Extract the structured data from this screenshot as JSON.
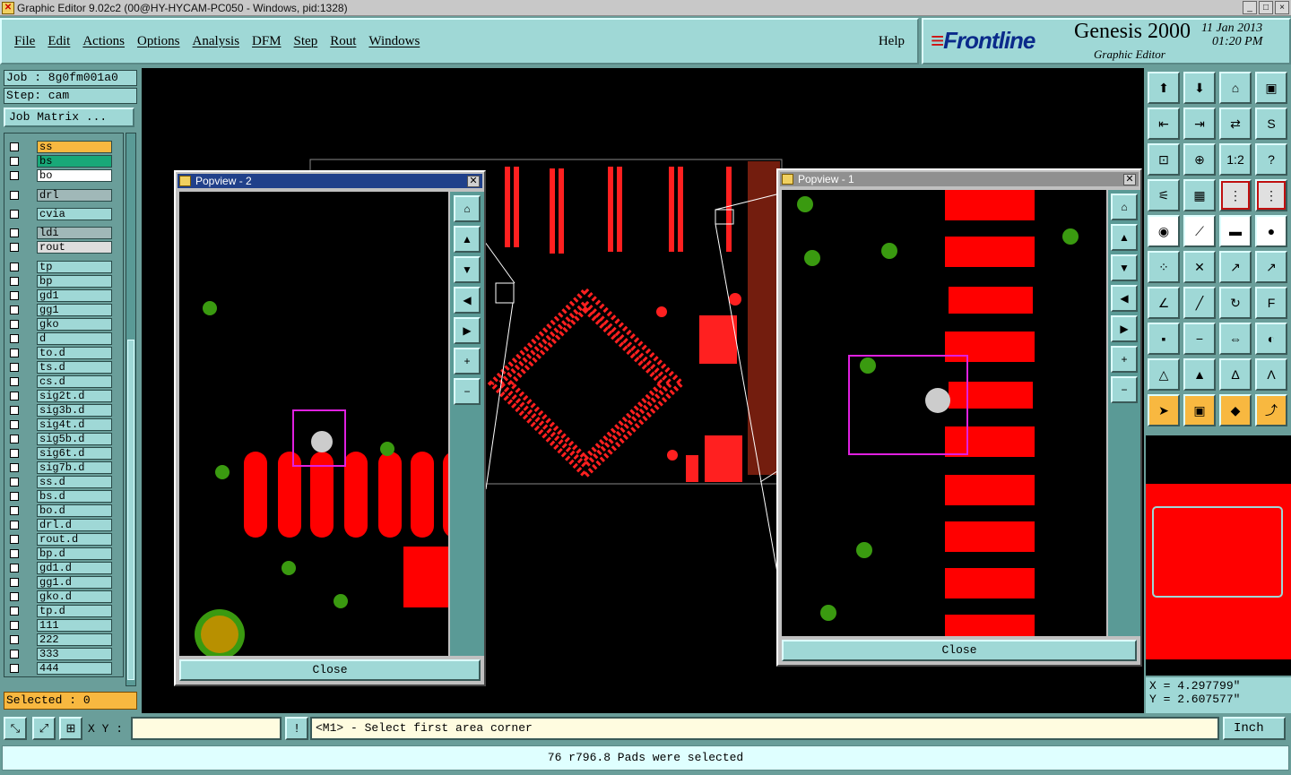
{
  "window": {
    "title": "Graphic Editor 9.02c2 (00@HY-HYCAM-PC050 - Windows, pid:1328)",
    "controls": [
      "_",
      "□",
      "×"
    ]
  },
  "menu": {
    "items": [
      "File",
      "Edit",
      "Actions",
      "Options",
      "Analysis",
      "DFM",
      "Step",
      "Rout",
      "Windows"
    ],
    "help": "Help"
  },
  "brand": {
    "logo": "Frontline",
    "product": "Genesis 2000",
    "subtitle": "Graphic Editor",
    "date": "11 Jan 2013",
    "time": "01:20 PM"
  },
  "job": {
    "job_label": "Job : 8g0fm001a0",
    "step_label": "Step: cam",
    "matrix_button": "Job Matrix ..."
  },
  "layers": [
    {
      "name": "ss",
      "color": "#f8b840"
    },
    {
      "name": "bs",
      "color": "#18a878"
    },
    {
      "name": "bo",
      "color": "#ffffff"
    },
    {
      "name": "drl",
      "color": "#a0b8b8"
    },
    {
      "name": "cvia",
      "color": "#9fd8d6"
    },
    {
      "name": "ldi",
      "color": "#a0b8b8"
    },
    {
      "name": "rout",
      "color": "#dddddd"
    },
    {
      "name": "tp",
      "color": "#9fd8d6"
    },
    {
      "name": "bp",
      "color": "#9fd8d6"
    },
    {
      "name": "gd1",
      "color": "#9fd8d6"
    },
    {
      "name": "gg1",
      "color": "#9fd8d6"
    },
    {
      "name": "gko",
      "color": "#9fd8d6"
    },
    {
      "name": "d",
      "color": "#9fd8d6"
    },
    {
      "name": "to.d",
      "color": "#9fd8d6"
    },
    {
      "name": "ts.d",
      "color": "#9fd8d6"
    },
    {
      "name": "cs.d",
      "color": "#9fd8d6"
    },
    {
      "name": "sig2t.d",
      "color": "#9fd8d6"
    },
    {
      "name": "sig3b.d",
      "color": "#9fd8d6"
    },
    {
      "name": "sig4t.d",
      "color": "#9fd8d6"
    },
    {
      "name": "sig5b.d",
      "color": "#9fd8d6"
    },
    {
      "name": "sig6t.d",
      "color": "#9fd8d6"
    },
    {
      "name": "sig7b.d",
      "color": "#9fd8d6"
    },
    {
      "name": "ss.d",
      "color": "#9fd8d6"
    },
    {
      "name": "bs.d",
      "color": "#9fd8d6"
    },
    {
      "name": "bo.d",
      "color": "#9fd8d6"
    },
    {
      "name": "drl.d",
      "color": "#9fd8d6"
    },
    {
      "name": "rout.d",
      "color": "#9fd8d6"
    },
    {
      "name": "bp.d",
      "color": "#9fd8d6"
    },
    {
      "name": "gd1.d",
      "color": "#9fd8d6"
    },
    {
      "name": "gg1.d",
      "color": "#9fd8d6"
    },
    {
      "name": "gko.d",
      "color": "#9fd8d6"
    },
    {
      "name": "tp.d",
      "color": "#9fd8d6"
    },
    {
      "name": "111",
      "color": "#9fd8d6"
    },
    {
      "name": "222",
      "color": "#9fd8d6"
    },
    {
      "name": "333",
      "color": "#9fd8d6"
    },
    {
      "name": "444",
      "color": "#9fd8d6"
    }
  ],
  "selected": "Selected : 0",
  "popview2": {
    "title": "Popview - 2",
    "close": "Close"
  },
  "popview1": {
    "title": "Popview - 1",
    "close": "Close"
  },
  "coords": {
    "x": "X = 4.297799\"",
    "y": "Y = 2.607577\""
  },
  "bottom": {
    "xy_label": "X Y :",
    "xy_value": "",
    "prompt": "<M1> - Select first area corner",
    "units": "Inch",
    "bang": "!"
  },
  "status": "76 r796.8 Pads were selected",
  "colors": {
    "pad_red": "#ff0000",
    "via_green": "#3a9a10",
    "highlight": "#e020e0",
    "panel_teal": "#9fd8d6"
  }
}
